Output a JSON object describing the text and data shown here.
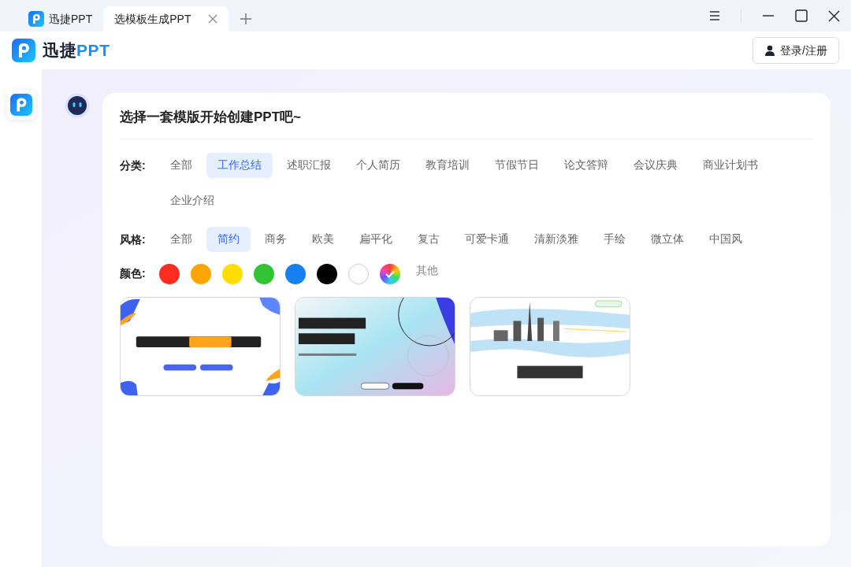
{
  "tabs": [
    {
      "label": "迅捷PPT",
      "selected": false,
      "kind": "home"
    },
    {
      "label": "选模板生成PPT",
      "selected": true,
      "kind": "page"
    }
  ],
  "header": {
    "logo_text": "迅捷",
    "logo_accent": "PPT",
    "login_button": "登录/注册"
  },
  "prompt": "选择一套模版开始创建PPT吧~",
  "category": {
    "label": "分类:",
    "options": [
      {
        "label": "全部",
        "selected": false
      },
      {
        "label": "工作总结",
        "selected": true
      },
      {
        "label": "述职汇报",
        "selected": false
      },
      {
        "label": "个人简历",
        "selected": false
      },
      {
        "label": "教育培训",
        "selected": false
      },
      {
        "label": "节假节日",
        "selected": false
      },
      {
        "label": "论文答辩",
        "selected": false
      },
      {
        "label": "会议庆典",
        "selected": false
      },
      {
        "label": "商业计划书",
        "selected": false
      },
      {
        "label": "企业介绍",
        "selected": false
      }
    ]
  },
  "style": {
    "label": "风格:",
    "options": [
      {
        "label": "全部",
        "selected": false
      },
      {
        "label": "简约",
        "selected": true
      },
      {
        "label": "商务",
        "selected": false
      },
      {
        "label": "欧美",
        "selected": false
      },
      {
        "label": "扁平化",
        "selected": false
      },
      {
        "label": "复古",
        "selected": false
      },
      {
        "label": "可爱卡通",
        "selected": false
      },
      {
        "label": "清新淡雅",
        "selected": false
      },
      {
        "label": "手绘",
        "selected": false
      },
      {
        "label": "微立体",
        "selected": false
      },
      {
        "label": "中国风",
        "selected": false
      }
    ]
  },
  "colors": {
    "label": "颜色:",
    "swatches": [
      {
        "kind": "solid",
        "color": "#ff2d20",
        "selected": false
      },
      {
        "kind": "solid",
        "color": "#ffa500",
        "selected": false
      },
      {
        "kind": "solid",
        "color": "#ffdd00",
        "selected": false
      },
      {
        "kind": "solid",
        "color": "#33c433",
        "selected": false
      },
      {
        "kind": "solid",
        "color": "#1680f0",
        "selected": false
      },
      {
        "kind": "solid",
        "color": "#000000",
        "selected": false
      },
      {
        "kind": "solid",
        "color": "#ffffff",
        "selected": false
      },
      {
        "kind": "rainbow",
        "selected": true
      }
    ],
    "other": "其他"
  }
}
